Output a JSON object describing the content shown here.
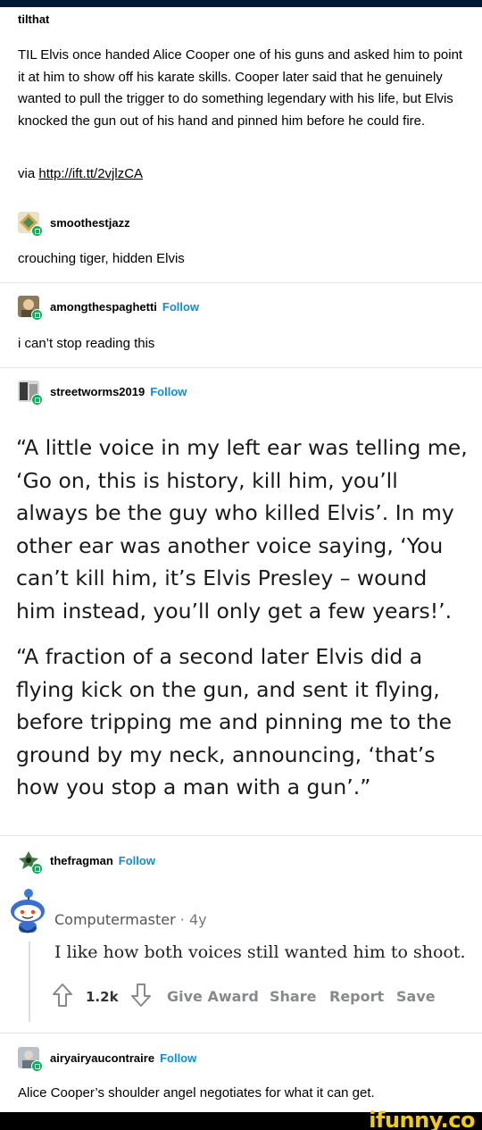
{
  "op": {
    "username": "tilthat",
    "text": "TIL Elvis once handed Alice Cooper one of his guns and asked him to point it at him to show off his karate skills. Cooper later said that he genuinely wanted to pull the trigger to do something legendary with his life, but Elvis knocked the gun out of his hand and pinned him before he could fire.",
    "via_prefix": "via",
    "via_link": "http://ift.tt/2vjlzCA"
  },
  "reblogs": [
    {
      "username": "smoothestjazz",
      "follow": "",
      "text": "crouching tiger, hidden Elvis"
    },
    {
      "username": "amongthespaghetti",
      "follow": "Follow",
      "text": "i can’t stop reading this"
    },
    {
      "username": "streetworms2019",
      "follow": "Follow"
    },
    {
      "username": "thefragman",
      "follow": "Follow"
    },
    {
      "username": "airyairyaucontraire",
      "follow": "Follow",
      "text": "Alice Cooper’s shoulder angel negotiates for what it can get."
    }
  ],
  "quote": {
    "para1": "“A little voice in my left ear was telling me, ‘Go on, this is history, kill him, you’ll always be the guy who killed Elvis’. In my other ear was another voice saying, ‘You can’t kill him, it’s Elvis Presley – wound him instead, you’ll only get a few years!’.",
    "para2": "“A fraction of a second later Elvis did a flying kick on the gun, and sent it flying, before tripping me and pinning me to the ground by my neck, announcing, ‘that’s how you stop a man with a gun’.”"
  },
  "reddit": {
    "username": "Computermaster",
    "separator": "·",
    "age": "4y",
    "comment": "I like how both voices still wanted him to shoot.",
    "score": "1.2k",
    "actions": {
      "award": "Give Award",
      "share": "Share",
      "report": "Report",
      "save": "Save"
    }
  },
  "watermark": "ifunny.co",
  "colors": {
    "follow": "#0d8de0",
    "reblog_badge": "#00b556",
    "top_bar": "#001935",
    "watermark": "#f5cd00"
  }
}
